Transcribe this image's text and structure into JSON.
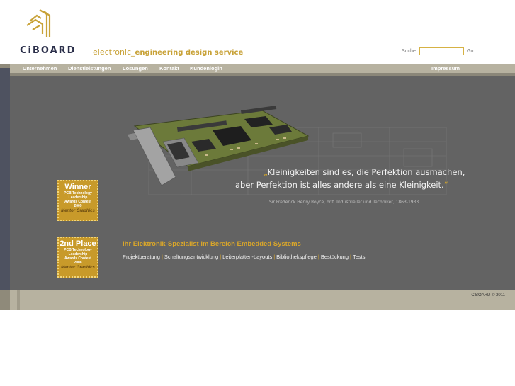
{
  "header": {
    "logo_text": "CiBOARD",
    "tagline_prefix": "electronic_",
    "tagline_bold": "engineering design service",
    "search_label": "Suche",
    "search_value": "",
    "search_go": "Go"
  },
  "nav": {
    "items": [
      "Unternehmen",
      "Dienstleistungen",
      "Lösungen",
      "Kontakt",
      "Kundenlogin"
    ],
    "impressum": "Impressum"
  },
  "hero": {
    "quote_open": "„",
    "quote_line1": "Kleinigkeiten sind es, die Perfektion ausmachen,",
    "quote_line2": "aber Perfektion ist alles andere als eine Kleinigkeit.",
    "quote_close": "“",
    "author": "Sir Frederick Henry Royce, brit. Industrieller und Techniker, 1863-1933"
  },
  "badges": [
    {
      "title": "Winner",
      "line1": "PCB Technology",
      "line2": "Leadership",
      "line3": "Awards Contest",
      "year": "2009",
      "brand": "Mentor Graphics"
    },
    {
      "title": "2nd Place",
      "line1": "PCB Technology",
      "line2": "Leadership",
      "line3": "Awards Contest",
      "year": "2008",
      "brand": "Mentor Graphics"
    }
  ],
  "specialist": {
    "title": "Ihr Elektronik-Spezialist im Bereich Embedded Systems",
    "links": [
      "Projektberatung",
      "Schaltungsentwicklung",
      "Leiterplatten-Layouts",
      "Bibliothekspflege",
      "Bestückung",
      "Tests"
    ]
  },
  "footer": {
    "copyright": "CiBOARD © 2011"
  },
  "colors": {
    "accent": "#d9a62a",
    "nav_bg": "#b7b2a0",
    "main_bg": "#636363",
    "brand_dark": "#2b2f4a"
  }
}
